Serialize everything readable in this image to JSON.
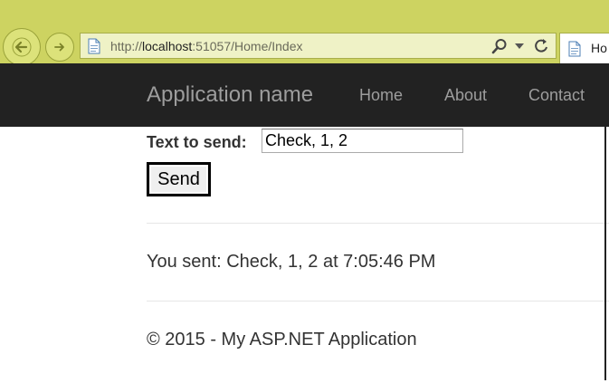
{
  "browser": {
    "url_prefix": "http://",
    "url_host": "localhost",
    "url_rest": ":51057/Home/Index",
    "tab_title": "Ho",
    "icons": [
      "back-arrow-icon",
      "forward-arrow-icon",
      "page-icon",
      "search-icon",
      "dropdown-icon",
      "refresh-icon"
    ]
  },
  "navbar": {
    "brand": "Application name",
    "links": [
      "Home",
      "About",
      "Contact"
    ]
  },
  "form": {
    "label": "Text to send:",
    "input_value": "Check, 1, 2",
    "button_label": "Send"
  },
  "result": {
    "text": "You sent: Check, 1, 2 at 7:05:46 PM"
  },
  "footer": {
    "text": "© 2015 - My ASP.NET Application"
  },
  "colors": {
    "chrome": "#cdd361",
    "navbar": "#222222",
    "nav_text": "#9d9d9d",
    "body_text": "#333333"
  }
}
